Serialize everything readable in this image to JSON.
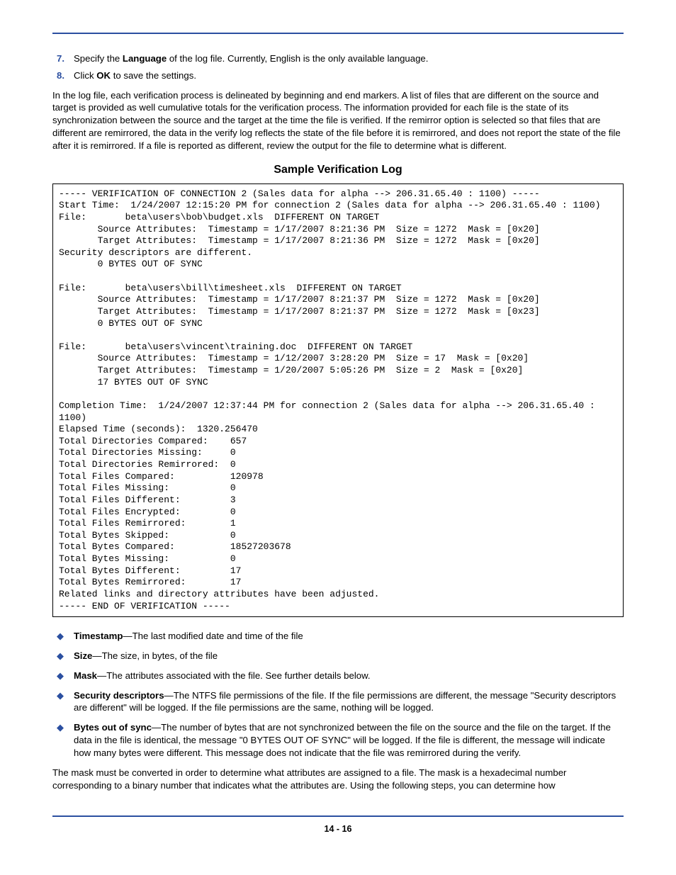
{
  "steps": [
    {
      "num": "7.",
      "html": "Specify the <b>Language</b> of the log file. Currently, English is the only available language."
    },
    {
      "num": "8.",
      "html": "Click <b>OK</b> to save the settings."
    }
  ],
  "intro_para": "In the log file, each verification process is delineated by beginning and end markers. A list of files that are different on the source and target is provided as well cumulative totals for the verification process. The information provided for each file is the state of its synchronization between the source and the target at the time the file is verified. If the remirror option is selected so that files that are different are remirrored, the data in the verify log reflects the state of the file before it is remirrored, and does not report the state of the file after it is remirrored. If a file is reported as different, review the output for the file to determine what is different.",
  "section_title": "Sample Verification Log",
  "log": "----- VERIFICATION OF CONNECTION 2 (Sales data for alpha --> 206.31.65.40 : 1100) -----\nStart Time:  1/24/2007 12:15:20 PM for connection 2 (Sales data for alpha --> 206.31.65.40 : 1100)\nFile:       beta\\users\\bob\\budget.xls  DIFFERENT ON TARGET\n       Source Attributes:  Timestamp = 1/17/2007 8:21:36 PM  Size = 1272  Mask = [0x20]\n       Target Attributes:  Timestamp = 1/17/2007 8:21:36 PM  Size = 1272  Mask = [0x20]\nSecurity descriptors are different.\n       0 BYTES OUT OF SYNC\n\nFile:       beta\\users\\bill\\timesheet.xls  DIFFERENT ON TARGET\n       Source Attributes:  Timestamp = 1/17/2007 8:21:37 PM  Size = 1272  Mask = [0x20]\n       Target Attributes:  Timestamp = 1/17/2007 8:21:37 PM  Size = 1272  Mask = [0x23]\n       0 BYTES OUT OF SYNC\n\nFile:       beta\\users\\vincent\\training.doc  DIFFERENT ON TARGET\n       Source Attributes:  Timestamp = 1/12/2007 3:28:20 PM  Size = 17  Mask = [0x20]\n       Target Attributes:  Timestamp = 1/20/2007 5:05:26 PM  Size = 2  Mask = [0x20]\n       17 BYTES OUT OF SYNC\n\nCompletion Time:  1/24/2007 12:37:44 PM for connection 2 (Sales data for alpha --> 206.31.65.40 : 1100)\nElapsed Time (seconds):  1320.256470\nTotal Directories Compared:    657\nTotal Directories Missing:     0\nTotal Directories Remirrored:  0\nTotal Files Compared:          120978\nTotal Files Missing:           0\nTotal Files Different:         3\nTotal Files Encrypted:         0\nTotal Files Remirrored:        1\nTotal Bytes Skipped:           0\nTotal Bytes Compared:          18527203678\nTotal Bytes Missing:           0\nTotal Bytes Different:         17\nTotal Bytes Remirrored:        17\nRelated links and directory attributes have been adjusted.\n----- END OF VERIFICATION -----",
  "bullets": [
    {
      "html": "<b>Timestamp</b>—The last modified date and time of the file"
    },
    {
      "html": "<b>Size</b>—The size, in bytes, of the file"
    },
    {
      "html": "<b>Mask</b>—The attributes associated with the file. See further details below."
    },
    {
      "html": "<b>Security descriptors</b>—The NTFS file permissions of the file. If the file permissions are different, the message \"Security descriptors are different\" will be logged. If the file permissions are the same, nothing will be logged."
    },
    {
      "html": "<b>Bytes out of sync</b>—The number of bytes that are not synchronized between the file on the source and the file on the target. If the data in the file is identical, the message \"0 BYTES OUT OF SYNC\" will be logged. If the file is different, the message will indicate how many bytes were different. This message does not indicate that the file was remirrored during the verify."
    }
  ],
  "closing_para": "The mask must be converted in order to determine what attributes are assigned to a file. The mask is a hexadecimal number corresponding to a binary number that indicates what the attributes are. Using the following steps, you can determine how",
  "page_number": "14 - 16"
}
